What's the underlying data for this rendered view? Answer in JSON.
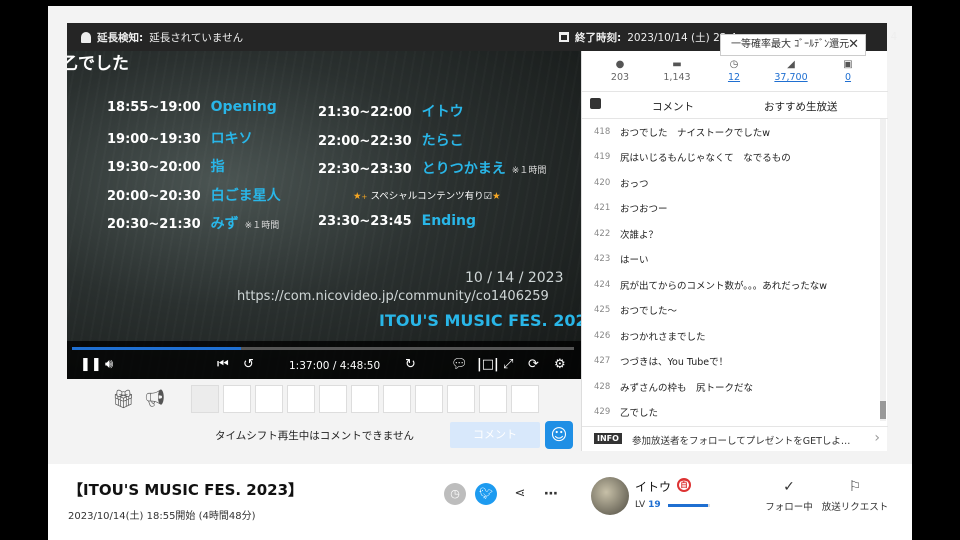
{
  "topbar": {
    "extension_label": "延長検知:",
    "extension_value": "延長されていません",
    "end_label": "終了時刻:",
    "end_value": "2023/10/14 (土) 23:4",
    "end_tail": "4"
  },
  "video": {
    "ticker": "乙でした",
    "schedule_left": [
      {
        "time": "18:55~19:00",
        "name": "Opening",
        "note": ""
      },
      {
        "time": "19:00~19:30",
        "name": "ロキソ",
        "note": ""
      },
      {
        "time": "19:30~20:00",
        "name": "指",
        "note": ""
      },
      {
        "time": "20:00~20:30",
        "name": "白ごま星人",
        "note": ""
      },
      {
        "time": "20:30~21:30",
        "name": "みず",
        "note": "※１時間"
      }
    ],
    "schedule_right": [
      {
        "time": "21:30~22:00",
        "name": "イトウ",
        "note": ""
      },
      {
        "time": "22:00~22:30",
        "name": "たらこ",
        "note": ""
      },
      {
        "time": "22:30~23:30",
        "name": "とりつかまえ",
        "note": "※１時間"
      },
      {
        "time": "23:30~23:45",
        "name": "Ending",
        "note": ""
      }
    ],
    "special": "スペシャルコンテンツ有り☑",
    "date": "10 / 14 / 2023",
    "url": "https://com.nicovideo.jp/community/co1406259",
    "fes_title": "ITOU'S MUSIC FES. 2023",
    "time_current": "1:37:00",
    "time_total": "4:48:50",
    "time_display": "1:37:00 / 4:48:50",
    "progress": 0.336
  },
  "comment_bar": {
    "message": "タイムシフト再生中はコメントできません",
    "submit_label": "コメント"
  },
  "panel": {
    "tooltip": "一等確率最大 ｺﾞｰﾙﾃﾞﾝ還元",
    "stats": {
      "viewers": "203",
      "comments": "1,143",
      "timeshift": "12",
      "ad_points": "37,700",
      "gifts": "0"
    },
    "tabs": {
      "comment": "コメント",
      "recommend": "おすすめ生放送"
    },
    "comments": [
      {
        "no": "418",
        "text": "おつでした　ナイストークでしたw"
      },
      {
        "no": "419",
        "text": "尻はいじるもんじゃなくて　なでるもの"
      },
      {
        "no": "420",
        "text": "おっつ"
      },
      {
        "no": "421",
        "text": "おつおつー"
      },
      {
        "no": "422",
        "text": "次誰よ？"
      },
      {
        "no": "423",
        "text": "はーい"
      },
      {
        "no": "424",
        "text": "尻が出てからのコメント数が。。。あれだったなw"
      },
      {
        "no": "425",
        "text": "おつでした～"
      },
      {
        "no": "426",
        "text": "おつかれさまでした"
      },
      {
        "no": "427",
        "text": "つづきは、You Tubeで！"
      },
      {
        "no": "428",
        "text": "みずさんの枠も　尻トークだな"
      },
      {
        "no": "429",
        "text": "乙でした"
      }
    ],
    "info_badge": "INFO",
    "info_text": "参加放送者をフォローしてプレゼントをGETしよ…"
  },
  "program": {
    "title": "【ITOU'S MUSIC FES. 2023】",
    "date": "2023/10/14(土) 18:55開始 (4時間48分)"
  },
  "broadcaster": {
    "name": "イトウ",
    "badge": "百",
    "level_label": "LV",
    "level": "19",
    "level_progress": 0.95,
    "follow_label": "フォロー中",
    "request_label": "放送リクエスト"
  },
  "colors": {
    "accent": "#1f6fd1",
    "fes_blue": "#29b6e8",
    "twitter": "#1d9bf0"
  }
}
